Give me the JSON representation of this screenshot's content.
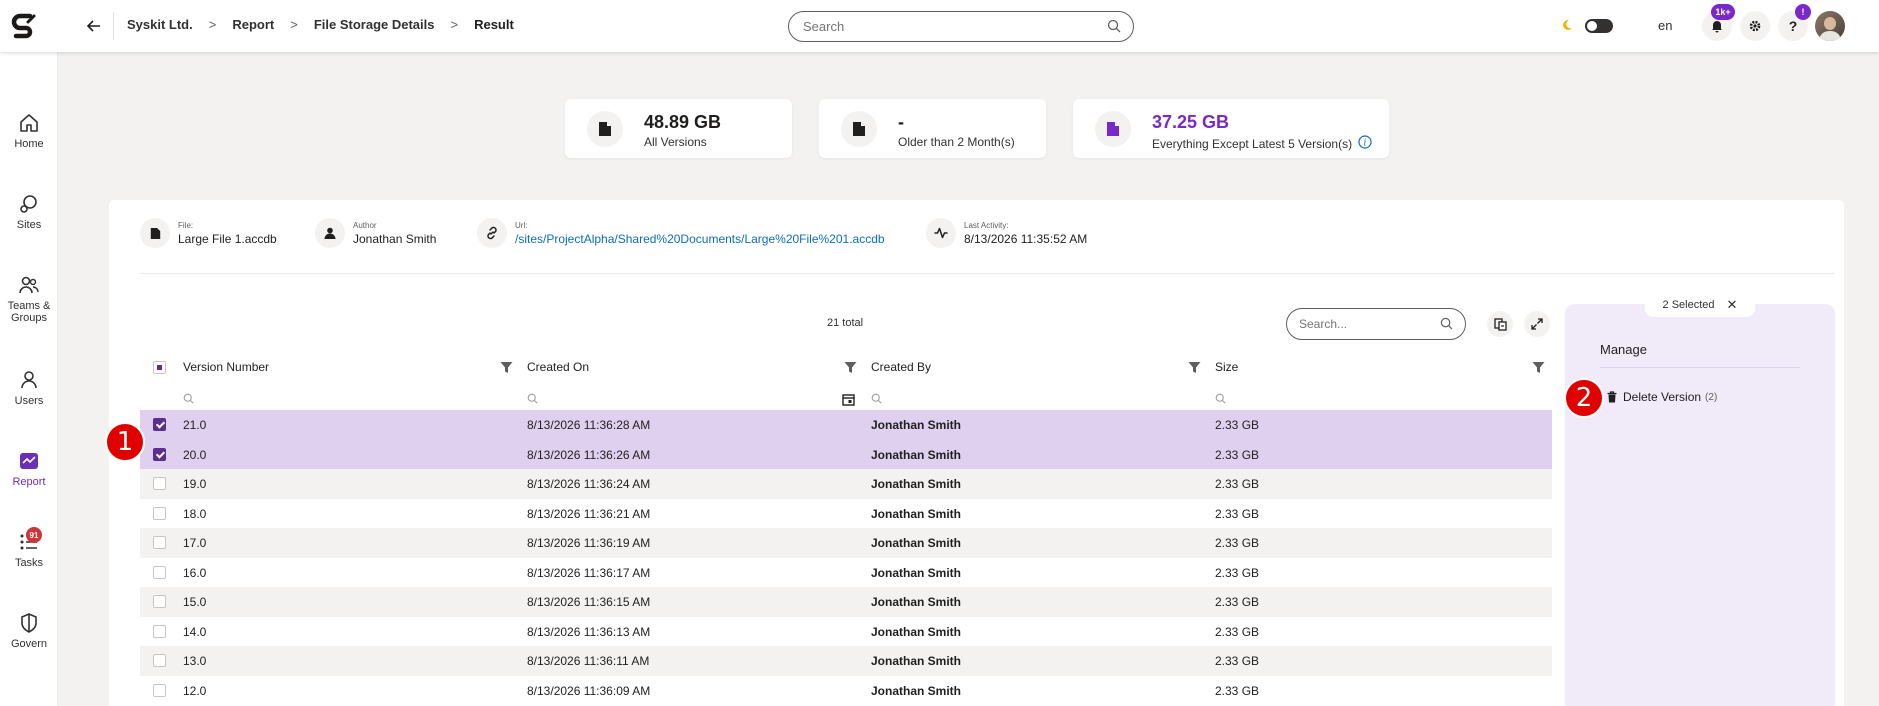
{
  "breadcrumb": [
    "Syskit Ltd.",
    "Report",
    "File Storage Details",
    "Result"
  ],
  "search": {
    "placeholder": "Search"
  },
  "header": {
    "language": "en",
    "notifications_badge": "1k+",
    "help_badge": "!"
  },
  "nav": [
    {
      "label": "Home",
      "icon": "home-icon"
    },
    {
      "label": "Sites",
      "icon": "sites-icon"
    },
    {
      "label": "Teams & Groups",
      "icon": "teams-icon"
    },
    {
      "label": "Users",
      "icon": "user-icon"
    },
    {
      "label": "Report",
      "icon": "report-icon",
      "active": true
    },
    {
      "label": "Tasks",
      "icon": "tasks-icon",
      "badge": "91"
    },
    {
      "label": "Govern",
      "icon": "shield-icon"
    }
  ],
  "cards": [
    {
      "value": "48.89 GB",
      "label": "All Versions"
    },
    {
      "value": "-",
      "label": "Older than 2 Month(s)"
    },
    {
      "value": "37.25 GB",
      "label": "Everything Except Latest 5 Version(s)"
    }
  ],
  "meta": [
    {
      "key": "File:",
      "value": "Large File 1.accdb"
    },
    {
      "key": "Author",
      "value": "Jonathan Smith"
    },
    {
      "key": "Url:",
      "value": "/sites/ProjectAlpha/Shared%20Documents/Large%20File%201.accdb"
    },
    {
      "key": "Last Activity:",
      "value": "8/13/2026 11:35:52 AM"
    }
  ],
  "grid": {
    "total": "21 total",
    "search_placeholder": "Search...",
    "columns": [
      "Version Number",
      "Created On",
      "Created By",
      "Size"
    ],
    "rows": [
      {
        "version": "21.0",
        "created_on": "8/13/2026 11:36:28 AM",
        "created_by": "Jonathan Smith",
        "size": "2.33 GB",
        "selected": true
      },
      {
        "version": "20.0",
        "created_on": "8/13/2026 11:36:26 AM",
        "created_by": "Jonathan Smith",
        "size": "2.33 GB",
        "selected": true
      },
      {
        "version": "19.0",
        "created_on": "8/13/2026 11:36:24 AM",
        "created_by": "Jonathan Smith",
        "size": "2.33 GB",
        "selected": false
      },
      {
        "version": "18.0",
        "created_on": "8/13/2026 11:36:21 AM",
        "created_by": "Jonathan Smith",
        "size": "2.33 GB",
        "selected": false
      },
      {
        "version": "17.0",
        "created_on": "8/13/2026 11:36:19 AM",
        "created_by": "Jonathan Smith",
        "size": "2.33 GB",
        "selected": false
      },
      {
        "version": "16.0",
        "created_on": "8/13/2026 11:36:17 AM",
        "created_by": "Jonathan Smith",
        "size": "2.33 GB",
        "selected": false
      },
      {
        "version": "15.0",
        "created_on": "8/13/2026 11:36:15 AM",
        "created_by": "Jonathan Smith",
        "size": "2.33 GB",
        "selected": false
      },
      {
        "version": "14.0",
        "created_on": "8/13/2026 11:36:13 AM",
        "created_by": "Jonathan Smith",
        "size": "2.33 GB",
        "selected": false
      },
      {
        "version": "13.0",
        "created_on": "8/13/2026 11:36:11 AM",
        "created_by": "Jonathan Smith",
        "size": "2.33 GB",
        "selected": false
      },
      {
        "version": "12.0",
        "created_on": "8/13/2026 11:36:09 AM",
        "created_by": "Jonathan Smith",
        "size": "2.33 GB",
        "selected": false
      }
    ]
  },
  "manage": {
    "selected_label": "2 Selected",
    "title": "Manage",
    "delete_label": "Delete Version",
    "delete_count": "(2)"
  },
  "callouts": [
    "1",
    "2"
  ],
  "colors": {
    "accent": "#7b28c9",
    "selected_row": "#e0d0f0",
    "manage_bg": "#f1eaf9",
    "callout": "#e00000"
  }
}
